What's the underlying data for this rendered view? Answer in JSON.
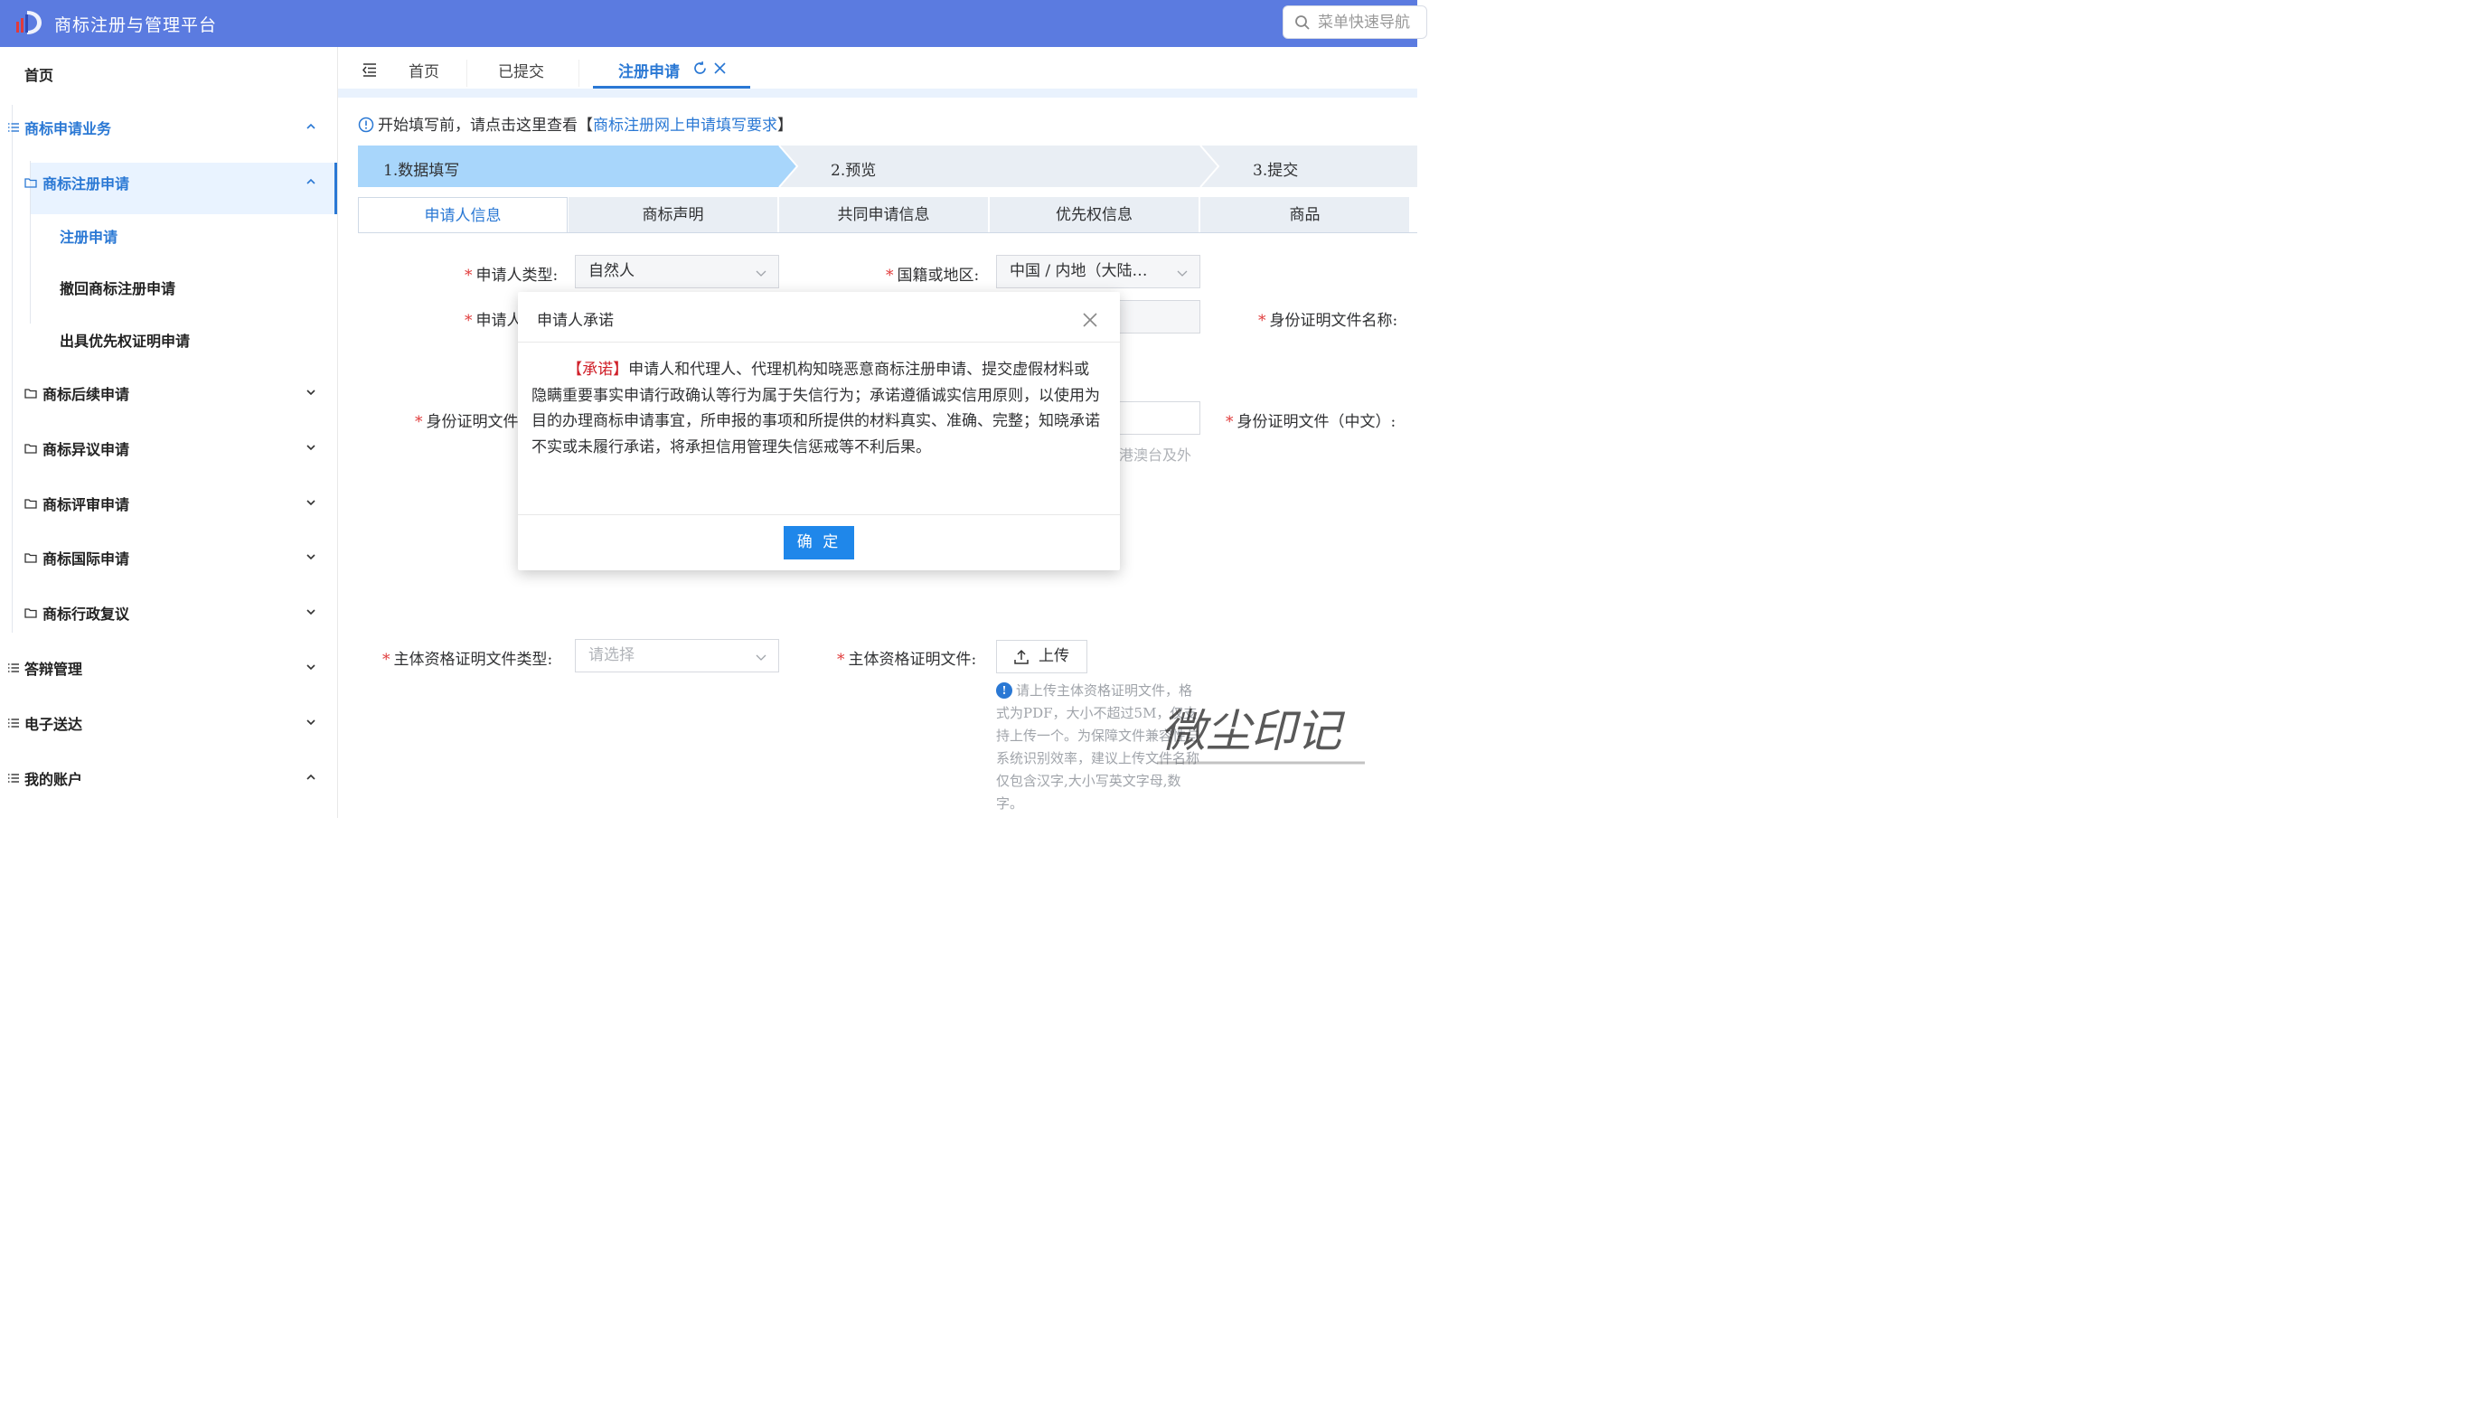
{
  "app": {
    "title": "商标注册与管理平台"
  },
  "nav_search": {
    "placeholder": "菜单快速导航"
  },
  "sidebar": {
    "items": [
      {
        "label": "首页"
      },
      {
        "label": "商标申请业务"
      },
      {
        "label": "商标注册申请"
      },
      {
        "label": "注册申请"
      },
      {
        "label": "撤回商标注册申请"
      },
      {
        "label": "出具优先权证明申请"
      },
      {
        "label": "商标后续申请"
      },
      {
        "label": "商标异议申请"
      },
      {
        "label": "商标评审申请"
      },
      {
        "label": "商标国际申请"
      },
      {
        "label": "商标行政复议"
      },
      {
        "label": "答辩管理"
      },
      {
        "label": "电子送达"
      },
      {
        "label": "我的账户"
      }
    ]
  },
  "tabs": {
    "home": "首页",
    "submitted": "已提交",
    "active": "注册申请"
  },
  "notice": {
    "prefix": "开始填写前，请点击这里查看【",
    "link": "商标注册网上申请填写要求",
    "suffix": "】"
  },
  "steps": [
    "1.数据填写",
    "2.预览",
    "3.提交"
  ],
  "form_tabs": [
    "申请人信息",
    "商标声明",
    "共同申请信息",
    "优先权信息",
    "商品"
  ],
  "form": {
    "applicant_type_label": "申请人类型:",
    "applicant_type_value": "自然人",
    "nationality_label": "国籍或地区:",
    "nationality_value": "中国 / 内地（大陆…",
    "applicant_name_label": "申请人",
    "id_doc_name_label": "身份证明文件名称:",
    "id_doc_label": "身份证明文件",
    "id_doc_cn_label": "身份证明文件（中文）:",
    "hmt_hint": "港澳台及外",
    "entity_doc_type_label": "主体资格证明文件类型:",
    "entity_doc_type_placeholder": "请选择",
    "entity_doc_label": "主体资格证明文件:",
    "upload_label": "上传",
    "upload_tip": "请上传主体资格证明文件，格式为PDF，大小不超过5M，仅支持上传一个。为保障文件兼容性与系统识别效率，建议上传文件名称仅包含汉字,大小写英文字母,数字。"
  },
  "dialog": {
    "title": "申请人承诺",
    "promise_tag": "【承诺】",
    "body": "申请人和代理人、代理机构知晓恶意商标注册申请、提交虚假材料或隐瞒重要事实申请行政确认等行为属于失信行为；承诺遵循诚实信用原则，以使用为目的办理商标申请事宜，所申报的事项和所提供的材料真实、准确、完整；知晓承诺不实或未履行承诺，将承担信用管理失信惩戒等不利后果。",
    "ok_label": "确 定"
  },
  "watermark": {
    "text": "微尘印记"
  },
  "colors": {
    "header": "#5b7be0",
    "accent": "#2a78d4",
    "required": "#e03a3a",
    "ok_button": "#1f87ea"
  }
}
